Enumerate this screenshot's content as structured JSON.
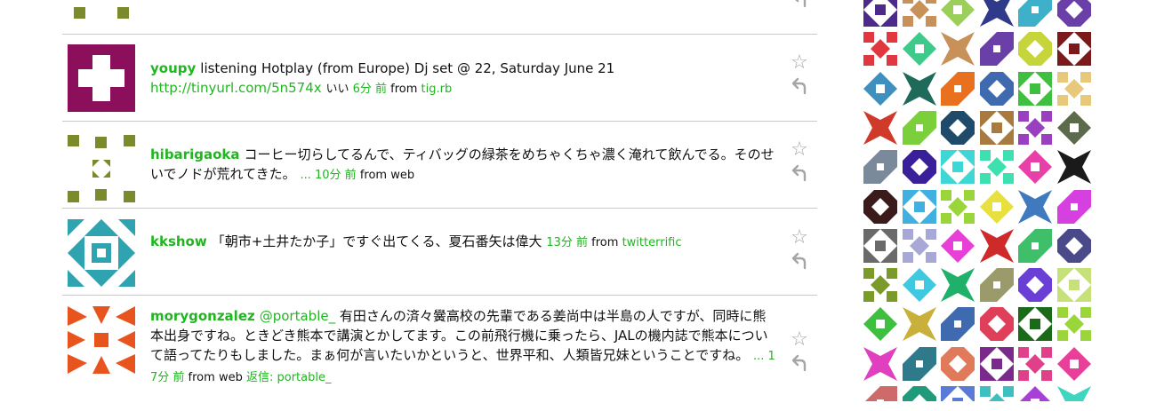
{
  "colors": {
    "accent_green": "#21b521",
    "divider": "#c9c9c9",
    "action_gray": "#a5a5a5"
  },
  "icons": {
    "favorite": "star-outline-icon",
    "reply": "reply-arrow-icon"
  },
  "top_partial": {
    "avatar_color": "#7b8a2a",
    "reply_icon": "reply-arrow-icon"
  },
  "tweets": [
    {
      "username": "youpy",
      "text": "listening Hotplay (from Europe) Dj set @ 22, Saturday June 21",
      "link": "http://tinyurl.com/5n574x",
      "text_after_link": "いい",
      "time": "6分 前",
      "from_label": "from",
      "source": "tig.rb",
      "avatar_color": "#8b0f5a",
      "favorite_icon": "star-outline-icon",
      "reply_icon": "reply-arrow-icon"
    },
    {
      "username": "hibarigaoka",
      "text": "コーヒー切らしてるんで、ティバッグの緑茶をめちゃくちゃ濃く淹れて飲んでる。そのせいでノドが荒れてきた。",
      "dots": "...",
      "time": "10分 前",
      "from_label": "from",
      "source": "web",
      "avatar_color": "#7b8a2a",
      "favorite_icon": "star-outline-icon",
      "reply_icon": "reply-arrow-icon"
    },
    {
      "username": "kkshow",
      "text": "「朝市+土井たか子」ですぐ出てくる、夏石番矢は偉大",
      "time": "13分 前",
      "from_label": "from",
      "source": "twitterrific",
      "avatar_color": "#2fa4b0",
      "favorite_icon": "star-outline-icon",
      "reply_icon": "reply-arrow-icon"
    },
    {
      "username": "morygonzalez",
      "mention": "@portable_",
      "text": "有田さんの済々黌高校の先輩である姜尚中は半島の人ですが、同時に熊本出身ですね。ときどき熊本で講演とかしてます。この前飛行機に乗ったら、JALの機内誌で熊本について語ってたりもしました。まぁ何が言いたいかというと、世界平和、人類皆兄妹ということですね。",
      "dots": "...",
      "time": "17分 前",
      "from_label": "from",
      "source": "web",
      "reply_label": "返信: portable_",
      "avatar_color": "#e8541e",
      "favorite_icon": "star-outline-icon",
      "reply_icon": "reply-arrow-icon"
    }
  ],
  "avatar_grid": {
    "colors": [
      "#4b2a8c",
      "#c8915a",
      "#9ccf5a",
      "#2f3a8a",
      "#3fb0c9",
      "#6a3fa8",
      "#e0383e",
      "#3fc98a",
      "#c8915a",
      "#6a3fa8",
      "#c6d63a",
      "#7a1a1a",
      "#3f8fbf",
      "#1f6a5a",
      "#e8701e",
      "#3f6ab0",
      "#3fbf3f",
      "#e8c87a",
      "#cf3a2a",
      "#7bcf3a",
      "#1f4a6a",
      "#a87a3f",
      "#9a3fbf",
      "#5a6a4a",
      "#7a8a9a",
      "#3a1f9a",
      "#3fd6d6",
      "#3fe0b0",
      "#e83fa8",
      "#1a1a1a",
      "#3a1a1a",
      "#3fb0e0",
      "#9ad63a",
      "#e8e03f",
      "#3f7abf",
      "#d63fe0",
      "#6a6a6a",
      "#a8a8d6",
      "#e83fd6",
      "#cf2a2a",
      "#3fbf6a",
      "#4a4a8a",
      "#7a9a2a",
      "#3fc9e0",
      "#1fb06a",
      "#9a9a6a",
      "#6a3fd6",
      "#c6e07a",
      "#3fbf3f",
      "#c8b03a",
      "#3f6ab0",
      "#e03f5a",
      "#1a6a1a",
      "#9ad63a",
      "#e03fbf",
      "#2f7a8a",
      "#e07a5a",
      "#7a2a8a",
      "#e03f8a",
      "#e83f9a",
      "#cf6a6a",
      "#1f9a7a",
      "#5a7ad6",
      "#3fbfbf",
      "#a83fd6",
      "#3fd6bf"
    ]
  }
}
